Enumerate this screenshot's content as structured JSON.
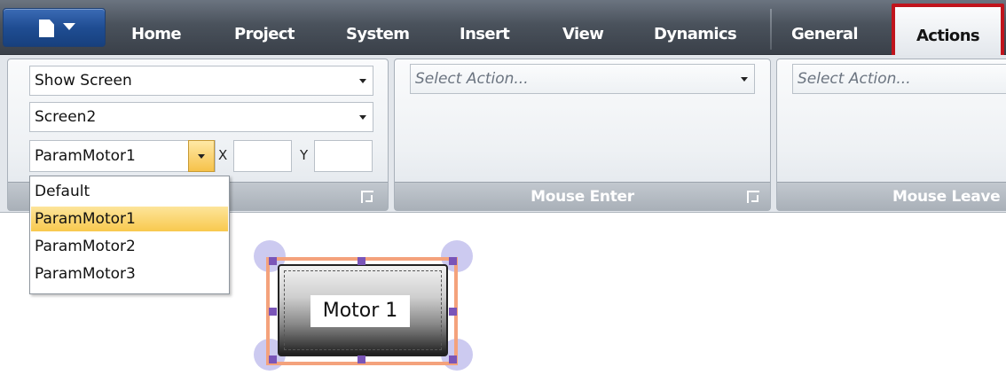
{
  "ribbon": {
    "tabs": [
      "Home",
      "Project",
      "System",
      "Insert",
      "View",
      "Dynamics",
      "General"
    ],
    "active_tab": "Actions"
  },
  "groups": {
    "mouse_click": {
      "action": "Show Screen",
      "screen": "Screen2",
      "parameter": "ParamMotor1",
      "x_label": "X",
      "y_label": "Y"
    },
    "mouse_enter": {
      "action_placeholder": "Select Action...",
      "title": "Mouse Enter"
    },
    "mouse_leave": {
      "action_placeholder": "Select Action...",
      "title": "Mouse Leave"
    }
  },
  "dropdown": {
    "options": [
      "Default",
      "ParamMotor1",
      "ParamMotor2",
      "ParamMotor3"
    ],
    "selected": "ParamMotor1"
  },
  "canvas": {
    "object_label": "Motor 1"
  },
  "colors": {
    "active_tab_highlight": "#c0141c",
    "selection_frame": "#f4a27c",
    "dropdown_selected": "#f8c94e"
  },
  "icons": [
    "app-menu-icon",
    "dropdown-arrow-icon",
    "dialog-launcher-icon",
    "resize-handle-icon"
  ]
}
